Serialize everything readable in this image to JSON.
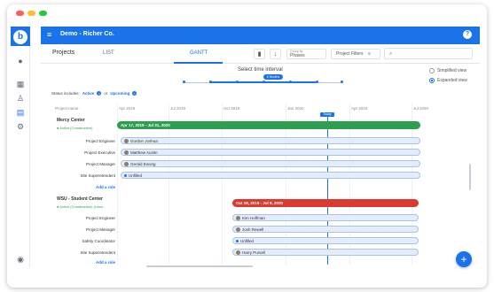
{
  "app": {
    "title": "Demo - Richer Co.",
    "logo_letter": "b"
  },
  "window_dots": [
    "#ff5f57",
    "#febc2e",
    "#28c840"
  ],
  "tabs": {
    "projects": "Projects",
    "list": "LIST",
    "gantt": "GANTT"
  },
  "toolbar": {
    "group_by": "Group by",
    "group_value": "Phases",
    "project_filters": "Project Filters"
  },
  "timeline": {
    "label": "Select time interval",
    "selected": "6 Months"
  },
  "views": {
    "simplified": "Simplified view",
    "expanded": "Expanded view"
  },
  "status_filter": {
    "label": "Status includes:",
    "active": "Active",
    "or": "or",
    "upcoming": "Upcoming"
  },
  "columns": [
    "Project name",
    "Apr 2019",
    "Jul 2019",
    "Oct 2019",
    "Jan 2020",
    "Apr 2020",
    "Jul 2020"
  ],
  "today_label": "Today",
  "projects": [
    {
      "name": "Mercy Center",
      "sub": "● Active (Construction)",
      "bar_label": "Apr 17, 2019 - Jul 31, 2020",
      "bar_color": "#2e9e4f",
      "roles": [
        {
          "role": "Project Engineer",
          "person": "Gordon Joshua"
        },
        {
          "role": "Project Executive",
          "person": "Matthew Austin"
        },
        {
          "role": "Project Manager",
          "person": "Gerald Ewong"
        },
        {
          "role": "Site Superintendent",
          "person": "Unfilled"
        }
      ],
      "add_role": "Add a role"
    },
    {
      "name": "WSU - Student Center",
      "sub": "● Active (Construction) (Unco...",
      "bar_label": "Oct 19, 2019 - Jul 9, 2020",
      "bar_color": "#d93b30",
      "roles": [
        {
          "role": "Project Engineer",
          "person": "Kim Hoffman"
        },
        {
          "role": "Project Manager",
          "person": "Josh Rewell"
        },
        {
          "role": "Safety Coordinator",
          "person": "Unfilled"
        },
        {
          "role": "Site Superintendent",
          "person": "Harry Pursell"
        }
      ],
      "add_role": "Add a role"
    }
  ]
}
